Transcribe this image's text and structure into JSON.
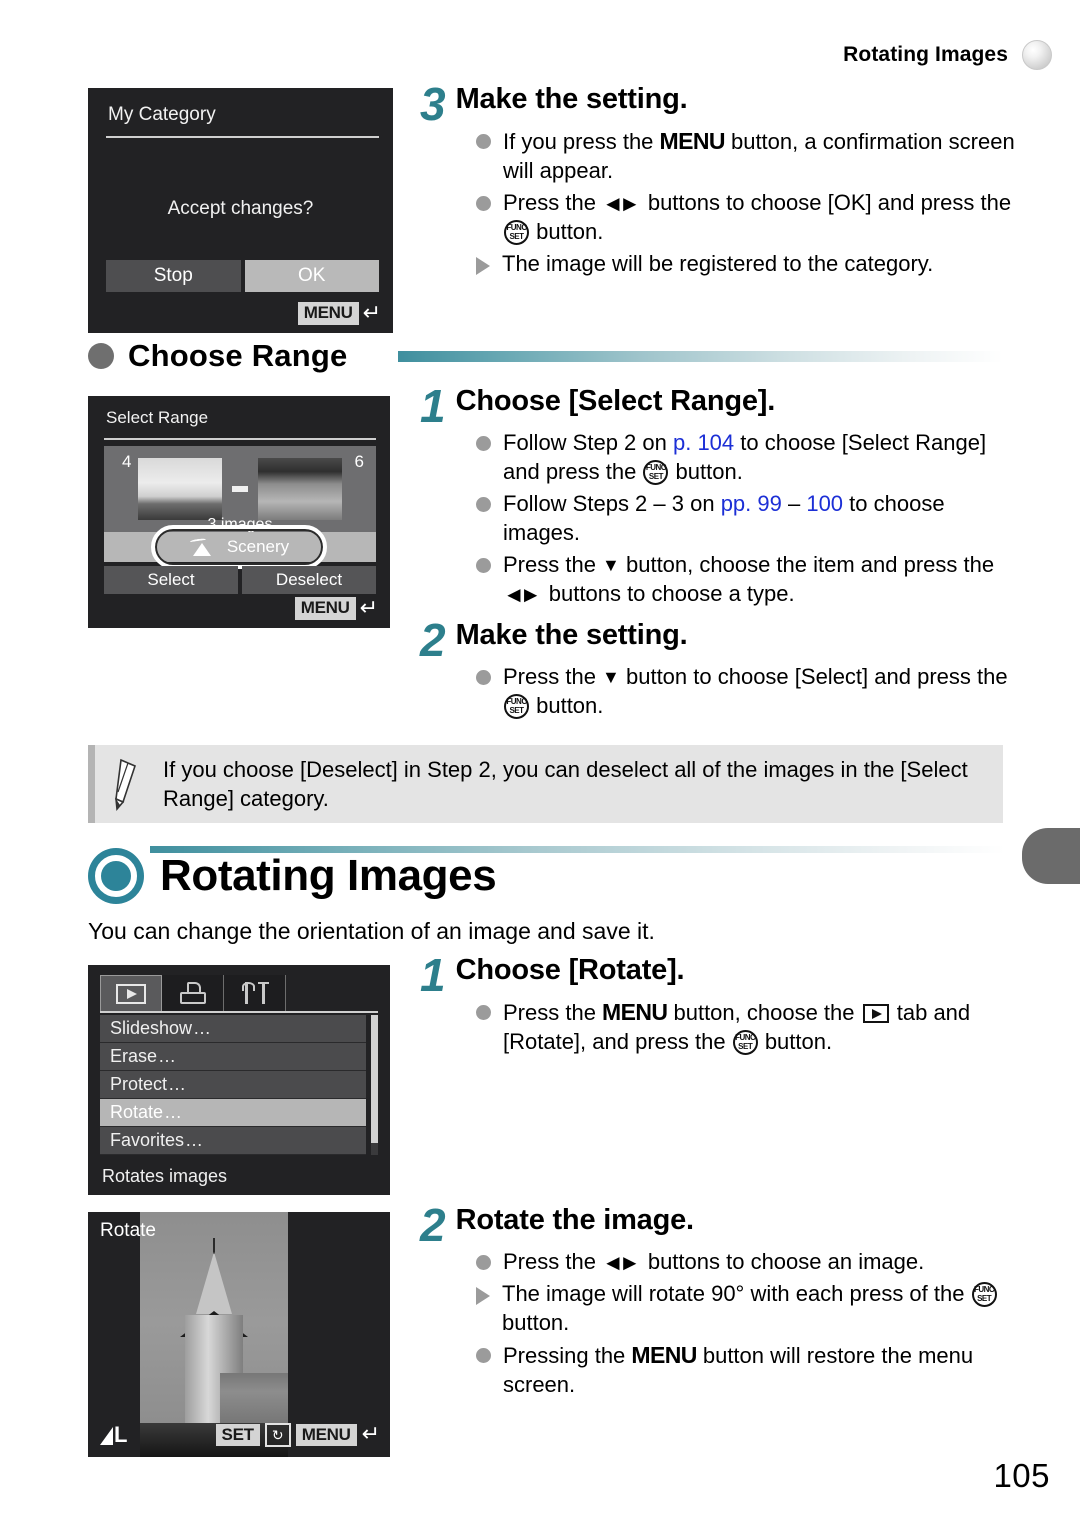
{
  "header": {
    "title": "Rotating Images"
  },
  "page_number": "105",
  "lcd_category": {
    "title": "My Category",
    "question": "Accept changes?",
    "stop_label": "Stop",
    "ok_label": "OK",
    "menu_badge": "MENU"
  },
  "step_my_category": {
    "number": "3",
    "title": "Make the setting.",
    "bullets": [
      {
        "mark": "dot",
        "parts": [
          {
            "t": "If you press the "
          },
          {
            "g": "MENU"
          },
          {
            "t": " button, a confirmation screen will appear."
          }
        ]
      },
      {
        "mark": "dot",
        "parts": [
          {
            "t": "Press the "
          },
          {
            "g": "LR"
          },
          {
            "t": " buttons to choose [OK] and press the "
          },
          {
            "g": "FUNC"
          },
          {
            "t": " button."
          }
        ]
      },
      {
        "mark": "tri",
        "parts": [
          {
            "t": "The image will be registered to the category."
          }
        ]
      }
    ]
  },
  "choose_range_heading": "Choose Range",
  "lcd_range": {
    "title": "Select Range",
    "first_index": "4",
    "last_index": "6",
    "image_count": "3 images",
    "category_label": "Scenery",
    "select_label": "Select",
    "deselect_label": "Deselect",
    "menu_badge": "MENU"
  },
  "step_select_range": {
    "number": "1",
    "title": "Choose [Select Range].",
    "bullets": [
      {
        "mark": "dot",
        "parts": [
          {
            "t": "Follow Step 2 on "
          },
          {
            "link": "p. 104"
          },
          {
            "t": " to choose [Select Range] and press the "
          },
          {
            "g": "FUNC"
          },
          {
            "t": " button."
          }
        ]
      },
      {
        "mark": "dot",
        "parts": [
          {
            "t": "Follow Steps 2 – 3 on "
          },
          {
            "link": "pp. 99"
          },
          {
            "t": " – "
          },
          {
            "link": "100"
          },
          {
            "t": " to choose images."
          }
        ]
      },
      {
        "mark": "dot",
        "parts": [
          {
            "t": "Press the "
          },
          {
            "g": "DOWN"
          },
          {
            "t": " button, choose the item and press the "
          },
          {
            "g": "LR"
          },
          {
            "t": " buttons to choose a type."
          }
        ]
      }
    ]
  },
  "step_range_setting": {
    "number": "2",
    "title": "Make the setting.",
    "bullets": [
      {
        "mark": "dot",
        "parts": [
          {
            "t": "Press the "
          },
          {
            "g": "DOWN"
          },
          {
            "t": " button to choose [Select] and press the "
          },
          {
            "g": "FUNC"
          },
          {
            "t": " button."
          }
        ]
      }
    ]
  },
  "note": {
    "icon": "pencil-icon",
    "text": "If you choose [Deselect] in Step 2, you can deselect all of the images in the [Select Range] category."
  },
  "chapter": {
    "icon": "ring-circle-icon",
    "title": "Rotating Images",
    "intro": "You can change the orientation of an image and save it."
  },
  "lcd_menu": {
    "tabs": [
      "playback-tab",
      "print-tab",
      "settings-tab"
    ],
    "items": [
      {
        "label": "Slideshow",
        "ellipsis": "…",
        "selected": false
      },
      {
        "label": "Erase",
        "ellipsis": "…",
        "selected": false
      },
      {
        "label": "Protect",
        "ellipsis": "…",
        "selected": false
      },
      {
        "label": "Rotate",
        "ellipsis": "…",
        "selected": true
      },
      {
        "label": "Favorites",
        "ellipsis": "…",
        "selected": false
      }
    ],
    "hint": "Rotates images"
  },
  "step_choose_rotate": {
    "number": "1",
    "title": "Choose [Rotate].",
    "bullets": [
      {
        "mark": "dot",
        "parts": [
          {
            "t": "Press the "
          },
          {
            "g": "MENU"
          },
          {
            "t": " button, choose the "
          },
          {
            "g": "PLAY"
          },
          {
            "t": " tab and [Rotate], and press the "
          },
          {
            "g": "FUNC"
          },
          {
            "t": " button."
          }
        ]
      }
    ]
  },
  "lcd_rotate": {
    "title": "Rotate",
    "quality": "L",
    "set_badge": "SET",
    "rotate_badge": "↻",
    "menu_badge": "MENU"
  },
  "step_rotate_image": {
    "number": "2",
    "title": "Rotate the image.",
    "bullets": [
      {
        "mark": "dot",
        "parts": [
          {
            "t": "Press the "
          },
          {
            "g": "LR"
          },
          {
            "t": " buttons to choose an image."
          }
        ]
      },
      {
        "mark": "tri",
        "parts": [
          {
            "t": "The image will rotate 90° with each press of the "
          },
          {
            "g": "FUNC"
          },
          {
            "t": " button."
          }
        ]
      },
      {
        "mark": "dot",
        "parts": [
          {
            "t": "Pressing the "
          },
          {
            "g": "MENU"
          },
          {
            "t": " button will restore the menu screen."
          }
        ]
      }
    ]
  },
  "colors": {
    "accent_teal": "#2d7f8c",
    "link_blue": "#1c2fd6",
    "note_bg": "#e4e4e4",
    "lcd_bg": "#222224"
  }
}
